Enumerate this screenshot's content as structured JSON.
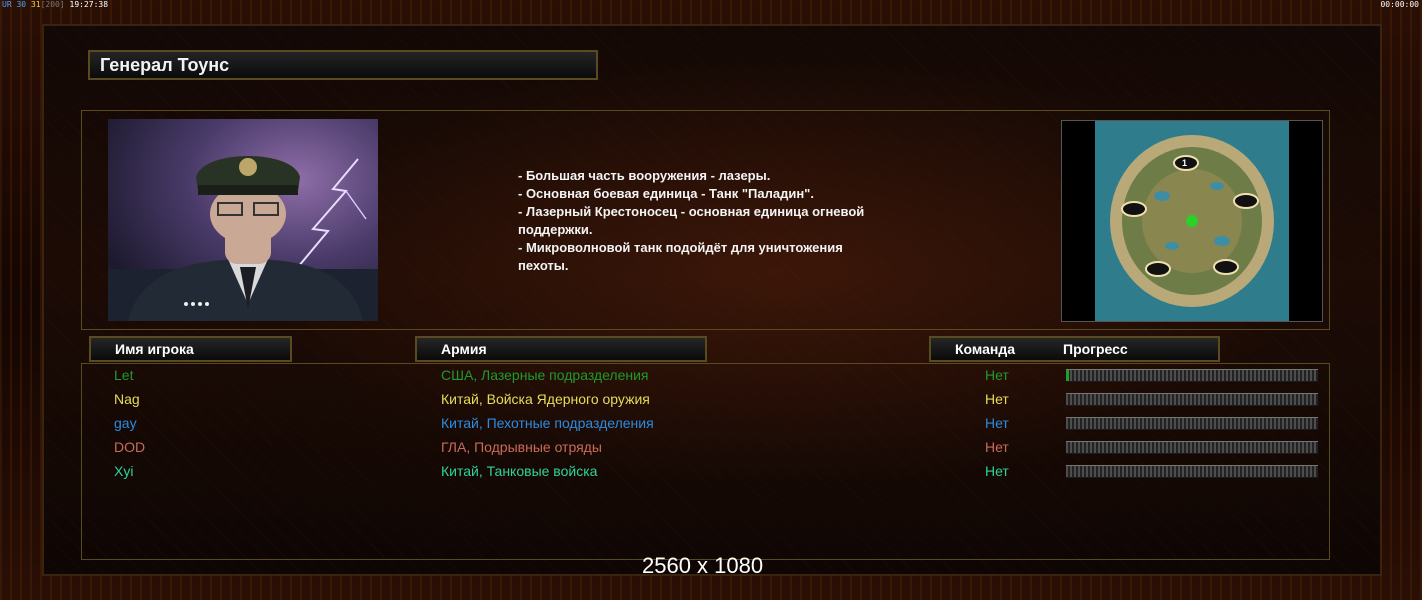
{
  "hud": {
    "left_prefix": "UR",
    "fps1": "30",
    "fps2": "31",
    "limit": "[200]",
    "clock": "19:27:38",
    "right_clock": "00:00:00"
  },
  "general": {
    "title": "Генерал Тоунс",
    "description": "- Большая часть вооружения - лазеры.\n- Основная боевая единица - Танк \"Паладин\".\n- Лазерный Крестоносец - основная единица огневой\n поддержки.\n- Микроволновой танк подойдёт для уничтожения\n пехоты."
  },
  "map": {
    "start_marker": "1"
  },
  "columns": {
    "player": "Имя игрока",
    "army": "Армия",
    "team": "Команда",
    "progress": "Прогресс"
  },
  "players": [
    {
      "name": "Let",
      "army": "США, Лазерные подразделения",
      "team": "Нет",
      "color": "#1f9b2b",
      "progress": 0.01
    },
    {
      "name": "Nag",
      "army": "Китай, Войска Ядерного оружия",
      "team": "Нет",
      "color": "#e8dd55",
      "progress": 0
    },
    {
      "name": "gay",
      "army": "Китай, Пехотные подразделения",
      "team": "Нет",
      "color": "#2d8be0",
      "progress": 0
    },
    {
      "name": "DOD",
      "army": "ГЛА, Подрывные отряды",
      "team": "Нет",
      "color": "#c96b57",
      "progress": 0
    },
    {
      "name": "Xyi",
      "army": "Китай, Танковые войска",
      "team": "Нет",
      "color": "#2fd39a",
      "progress": 0
    }
  ],
  "resolution": "2560 x 1080"
}
